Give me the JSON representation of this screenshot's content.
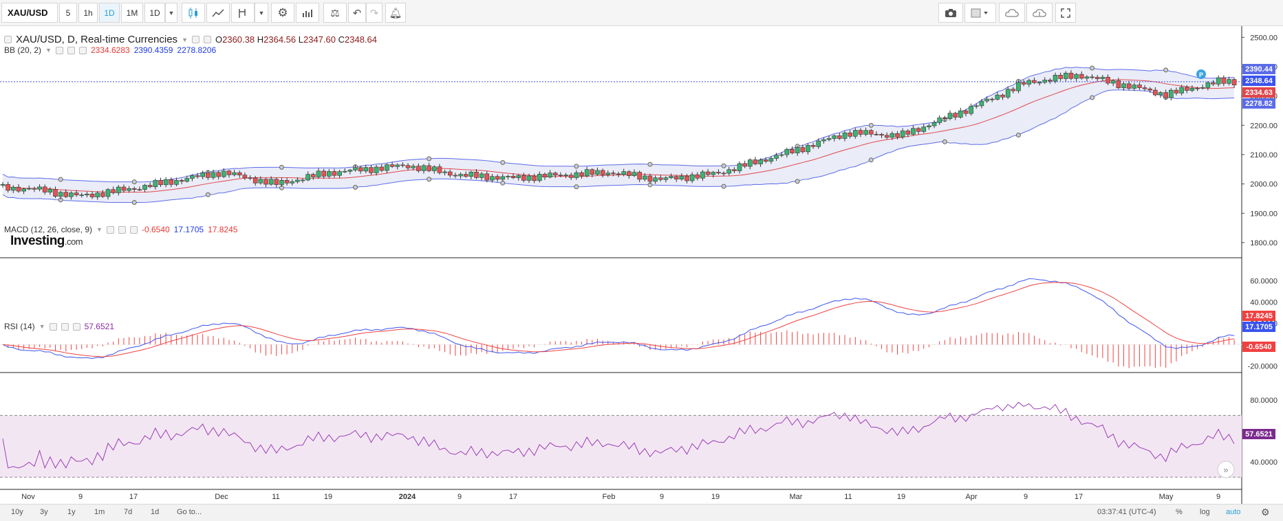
{
  "toolbar": {
    "symbol": "XAU/USD",
    "intervals": [
      "5",
      "1h",
      "1D",
      "1M",
      "1D"
    ],
    "active_interval_index": 2
  },
  "main_legend": {
    "title": "XAU/USD, D, Real-time Currencies",
    "open_label": "O",
    "open": "2360.38",
    "high_label": "H",
    "high": "2364.56",
    "low_label": "L",
    "low": "2347.60",
    "close_label": "C",
    "close": "2348.64",
    "bb_label": "BB (20, 2)",
    "bb_values": [
      "2334.6283",
      "2390.4359",
      "2278.8206"
    ]
  },
  "macd_legend": {
    "label": "MACD (12, 26, close, 9)",
    "values": [
      "-0.6540",
      "17.1705",
      "17.8245"
    ]
  },
  "rsi_legend": {
    "label": "RSI (14)",
    "value": "57.6521"
  },
  "logo": {
    "brand": "Investing",
    "suffix": ".com"
  },
  "price_axis": {
    "ticks": [
      "2500.00",
      "2400.00",
      "2300.00",
      "2200.00",
      "2100.00",
      "2000.00",
      "1900.00",
      "1800.00"
    ],
    "badges": {
      "bb_upper": "2390.44",
      "last": "2348.64",
      "bb_mid": "2334.63",
      "bb_lower": "2278.82"
    }
  },
  "macd_axis": {
    "ticks": [
      "60.0000",
      "40.0000",
      "20.0000",
      "-20.0000"
    ],
    "badges": {
      "signal": "17.8245",
      "macd": "17.1705",
      "hist": "-0.6540"
    }
  },
  "rsi_axis": {
    "ticks": [
      "80.0000",
      "40.0000"
    ],
    "badge": "57.6521"
  },
  "x_axis": {
    "labels": [
      "Nov",
      "9",
      "17",
      "Dec",
      "11",
      "19",
      "2024",
      "9",
      "17",
      "Feb",
      "9",
      "19",
      "Mar",
      "11",
      "19",
      "Apr",
      "9",
      "17",
      "May",
      "9"
    ]
  },
  "bottom_bar": {
    "ranges": [
      "10y",
      "3y",
      "1y",
      "1m",
      "7d",
      "1d"
    ],
    "goto": "Go to...",
    "time": "03:37:41 (UTC-4)",
    "pct": "%",
    "log": "log",
    "auto": "auto"
  },
  "colors": {
    "up": "#3cb371",
    "down": "#e55353",
    "bb": "#5b6be8",
    "bb_fill": "#e8eaf6",
    "mid": "#e0474c",
    "macd": "#3a53f0",
    "signal": "#f04040",
    "rsi": "#9a3fb5",
    "rsi_fill": "#f3e6f3"
  },
  "chart_data": {
    "type": "candlestick",
    "series": [
      {
        "name": "XAU/USD",
        "x": [
          "Nov",
          "9",
          "17",
          "Dec",
          "11",
          "19",
          "2024",
          "9",
          "17",
          "Feb",
          "9",
          "19",
          "Mar",
          "11",
          "19",
          "Apr",
          "9",
          "17",
          "May",
          "9"
        ],
        "close": [
          1985,
          1958,
          1985,
          2040,
          2000,
          2038,
          2063,
          2030,
          2020,
          2040,
          2015,
          2035,
          2115,
          2175,
          2165,
          2260,
          2345,
          2372,
          2305,
          2348.64
        ]
      },
      {
        "name": "BB (20, 2)",
        "values": [
          2334.6283,
          2390.4359,
          2278.8206
        ]
      },
      {
        "name": "MACD (12, 26, close, 9)",
        "values": [
          -0.654,
          17.1705,
          17.8245
        ]
      },
      {
        "name": "RSI (14)",
        "values": [
          57.6521
        ]
      }
    ],
    "ylim_price": [
      1760,
      2510
    ],
    "ylim_macd": [
      -25,
      72
    ],
    "ylim_rsi": [
      23,
      92
    ],
    "rsi_bands": [
      70,
      30
    ]
  }
}
